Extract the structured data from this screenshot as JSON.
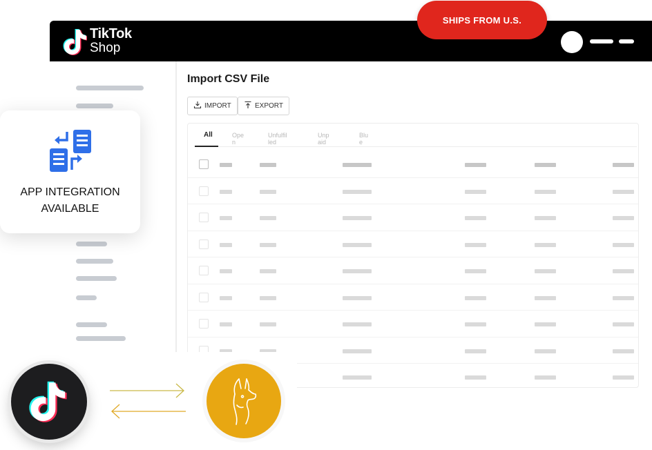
{
  "header": {
    "logo_line1": "TikTok",
    "logo_line2": "Shop",
    "badge": "SHIPS FROM U.S."
  },
  "main": {
    "title": "Import CSV File",
    "import_label": "IMPORT",
    "export_label": "EXPORT",
    "tabs": [
      {
        "label": "All",
        "active": true
      },
      {
        "label": "Ope n",
        "active": false
      },
      {
        "label": "Unfulfil led",
        "active": false
      },
      {
        "label": "Unp aid",
        "active": false
      },
      {
        "label": "Blu e",
        "active": false
      }
    ]
  },
  "integration_card": {
    "line1": "APP INTEGRATION",
    "line2": "AVAILABLE",
    "icon": "sync-documents-icon"
  },
  "integration_row": {
    "left_icon": "tiktok-logo-icon",
    "right_icon": "dog-logo-icon",
    "arrows_icon": "two-way-arrows-icon"
  },
  "colors": {
    "header_bg": "#000000",
    "badge_bg": "#e0261d",
    "integration_icon": "#2f6fe8",
    "partner_bg": "#e8a712",
    "arrow_color": "#c9b948"
  }
}
